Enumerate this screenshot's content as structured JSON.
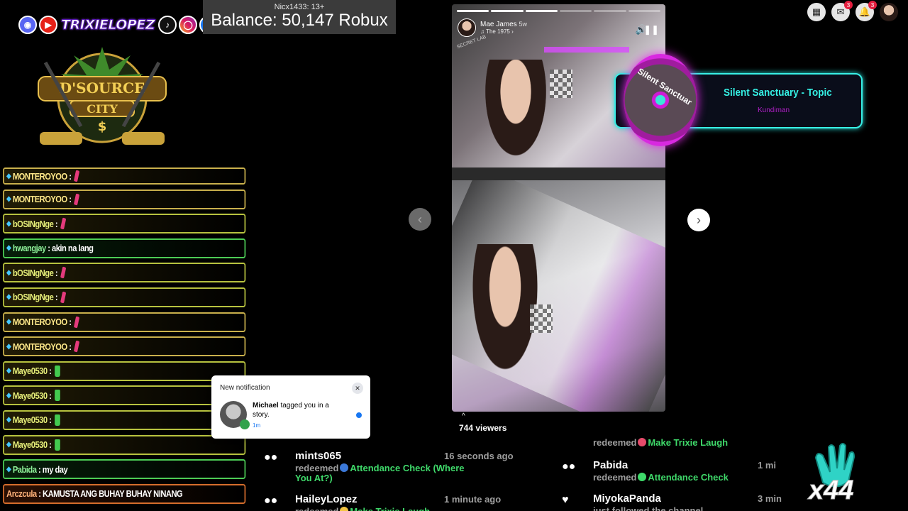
{
  "social": {
    "channel_name": "TRIXIELOPEZ",
    "icons": [
      "discord-icon",
      "youtube-icon",
      "tiktok-icon",
      "instagram-icon",
      "facebook-icon"
    ]
  },
  "logo": {
    "line1": "D'SOURCE",
    "line2": "CITY",
    "symbol": "$"
  },
  "balance": {
    "subtitle": "Nicx1433: 13+",
    "text": "Balance: 50,147 Robux"
  },
  "chat": [
    {
      "user": "MONTEROYOO",
      "msg": "",
      "emote": "pink",
      "color": "gold"
    },
    {
      "user": "MONTEROYOO",
      "msg": "",
      "emote": "pink",
      "color": "gold"
    },
    {
      "user": "bOSINgNge",
      "msg": "",
      "emote": "pink",
      "color": "olive"
    },
    {
      "user": "hwangjay",
      "msg": "akin na lang",
      "emote": "",
      "color": "green"
    },
    {
      "user": "bOSINgNge",
      "msg": "",
      "emote": "pink",
      "color": "olive"
    },
    {
      "user": "bOSINgNge",
      "msg": "",
      "emote": "pink",
      "color": "olive"
    },
    {
      "user": "MONTEROYOO",
      "msg": "",
      "emote": "pink",
      "color": "gold"
    },
    {
      "user": "MONTEROYOO",
      "msg": "",
      "emote": "pink",
      "color": "gold"
    },
    {
      "user": "Maye0530",
      "msg": "",
      "emote": "cup",
      "color": "olive"
    },
    {
      "user": "Maye0530",
      "msg": "",
      "emote": "cup",
      "color": "olive"
    },
    {
      "user": "Maye0530",
      "msg": "",
      "emote": "cup",
      "color": "olive"
    },
    {
      "user": "Maye0530",
      "msg": "",
      "emote": "cup",
      "color": "olive"
    },
    {
      "user": "Pabida",
      "msg": "my day",
      "emote": "",
      "color": "green"
    },
    {
      "user": "Arczcula",
      "msg": "KAMUSTA ANG BUHAY BUHAY NINANG",
      "emote": "",
      "color": "orange"
    }
  ],
  "story": {
    "user_name": "Mae James",
    "time_ago": "5w",
    "song": "The 1975",
    "watermark": "SECRET LAB",
    "progress_segments": 6,
    "progress_done": 3
  },
  "viewers": {
    "up_glyph": "^",
    "text": "744 viewers"
  },
  "now_playing": {
    "title": "Silent Sanctuary - Topic",
    "subtitle": "Kundiman",
    "disc_text": "Silent Sanctuar"
  },
  "top_right": {
    "menu_badge": "",
    "messenger_badge": "3",
    "notifications_badge": "3"
  },
  "notification": {
    "header": "New notification",
    "actor": "Michael",
    "text": " tagged you in a story.",
    "time": "1m"
  },
  "feed": {
    "left": [
      {
        "name": "mints065",
        "time": "16 seconds ago",
        "action": "redeemed",
        "reward": "Attendance Check (Where",
        "reward2": "You At?)",
        "dot": "blue"
      },
      {
        "name": "HaileyLopez",
        "time": "1 minute ago",
        "action": "redeemed",
        "reward": "Make Trixie Laugh",
        "dot": "yellow"
      }
    ],
    "right": [
      {
        "name": "",
        "time": "",
        "action": "redeemed",
        "reward": "Make Trixie Laugh",
        "dot": "pink"
      },
      {
        "name": "Pabida",
        "time": "1 mi",
        "action": "redeemed",
        "reward": "Attendance Check",
        "dot": "green"
      },
      {
        "name": "MiyokaPanda",
        "time": "3 min",
        "action": "just followed the channel",
        "reward": "",
        "dot": ""
      }
    ]
  },
  "combo": {
    "count": "x44"
  },
  "colors": {
    "chat_gold": "#c9b04c",
    "chat_green": "#4ccc55",
    "chat_orange": "#d56d2c",
    "now_playing_accent": "#35f0e4",
    "reward_green": "#3fd96a",
    "facebook_blue": "#1877f2"
  }
}
